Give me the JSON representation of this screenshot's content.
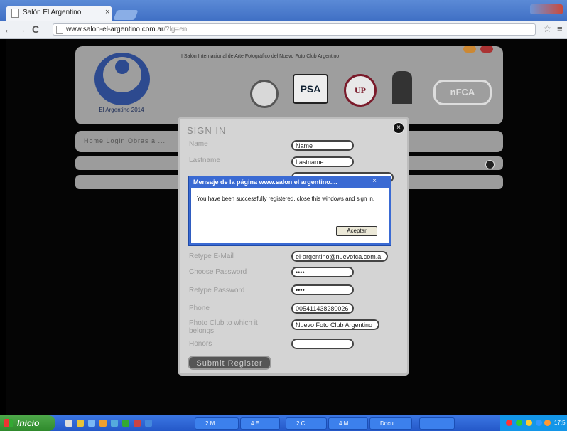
{
  "browser": {
    "tab_title": "Salón El Argentino",
    "tab_close": "×",
    "url_main": "www.salon-el-argentino.com.ar",
    "url_rest": "/?lg=en",
    "back": "←",
    "forward": "→",
    "reload": "C",
    "bookmark": "☆",
    "menu": "≡"
  },
  "site": {
    "header_text": "I Salón Internacional de Arte Fotográfico del Nuevo Foto Club Argentino",
    "logo_text": "El Argentino 2014",
    "nav_text": "Home   Login   Obras a  ...",
    "psa_label": "PSA",
    "fiap_label": "UP",
    "faf_label": "nFCA"
  },
  "signin": {
    "title": "SIGN IN",
    "close": "×",
    "fields": [
      {
        "label": "Name",
        "value": "Name"
      },
      {
        "label": "Lastname",
        "value": "Lastname"
      },
      {
        "label": "Retype E-Mail",
        "value": "el-argentino@nuevofca.com.a"
      },
      {
        "label": "Choose Password",
        "value": "••••"
      },
      {
        "label": "Retype Password",
        "value": "••••"
      },
      {
        "label": "Phone",
        "value": "005411438280026"
      },
      {
        "label": "Photo Club to which it belongs",
        "value": "Nuevo Foto Club Argentino"
      },
      {
        "label": "Honors",
        "value": ""
      }
    ],
    "submit_label": "Submit Register"
  },
  "alert": {
    "title": "Mensaje de la página www.salon el argentino....",
    "close": "×",
    "message": "You have been successfully registered, close this windows and sign in.",
    "button": "Aceptar"
  },
  "taskbar": {
    "start": "Inicio",
    "tasks": [
      "2 M...",
      "4 E...",
      "2 C...",
      "4 M...",
      "Docu...",
      "..."
    ],
    "clock": "17:5"
  }
}
